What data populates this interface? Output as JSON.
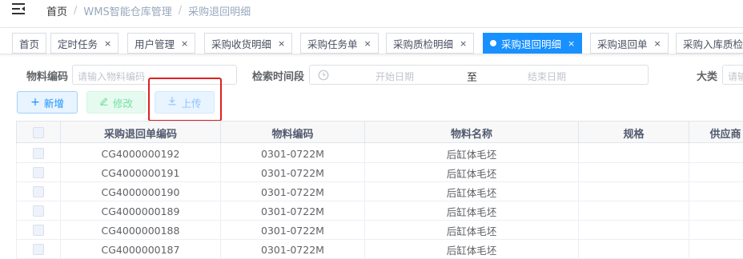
{
  "breadcrumb": {
    "home": "首页",
    "level1": "WMS智能仓库管理",
    "level2": "采购退回明细"
  },
  "tabs": [
    {
      "label": "首页",
      "closable": false,
      "active": false
    },
    {
      "label": "定时任务",
      "closable": true,
      "active": false
    },
    {
      "label": "用户管理",
      "closable": true,
      "active": false
    },
    {
      "label": "采购收货明细",
      "closable": true,
      "active": false
    },
    {
      "label": "采购任务单",
      "closable": true,
      "active": false
    },
    {
      "label": "采购质检明细",
      "closable": true,
      "active": false
    },
    {
      "label": "采购退回明细",
      "closable": true,
      "active": true
    },
    {
      "label": "采购退回单",
      "closable": true,
      "active": false
    },
    {
      "label": "采购入库质检",
      "closable": false,
      "active": false
    }
  ],
  "close_glyph": "×",
  "search": {
    "material_code_label": "物料编码",
    "material_code_placeholder": "请输入物料编码",
    "time_label": "检索时间段",
    "start_placeholder": "开始日期",
    "range_sep": "至",
    "end_placeholder": "结束日期",
    "category_label": "大类",
    "category_placeholder": "请输"
  },
  "toolbar": {
    "add_label": "新增",
    "edit_label": "修改",
    "upload_label": "上传"
  },
  "table": {
    "columns": [
      "",
      "采购退回单编码",
      "物料编码",
      "物料名称",
      "规格",
      "供应商"
    ],
    "rows": [
      [
        "CG4000000192",
        "0301-0722M",
        "后缸体毛坯",
        ""
      ],
      [
        "CG4000000191",
        "0301-0722M",
        "后缸体毛坯",
        ""
      ],
      [
        "CG4000000190",
        "0301-0722M",
        "后缸体毛坯",
        ""
      ],
      [
        "CG4000000189",
        "0301-0722M",
        "后缸体毛坯",
        ""
      ],
      [
        "CG4000000188",
        "0301-0722M",
        "后缸体毛坯",
        ""
      ],
      [
        "CG4000000187",
        "0301-0722M",
        "后缸体毛坯",
        ""
      ]
    ]
  },
  "colors": {
    "primary": "#1890ff",
    "success_light": "#71e2a3",
    "annotation_red": "#e02020"
  }
}
